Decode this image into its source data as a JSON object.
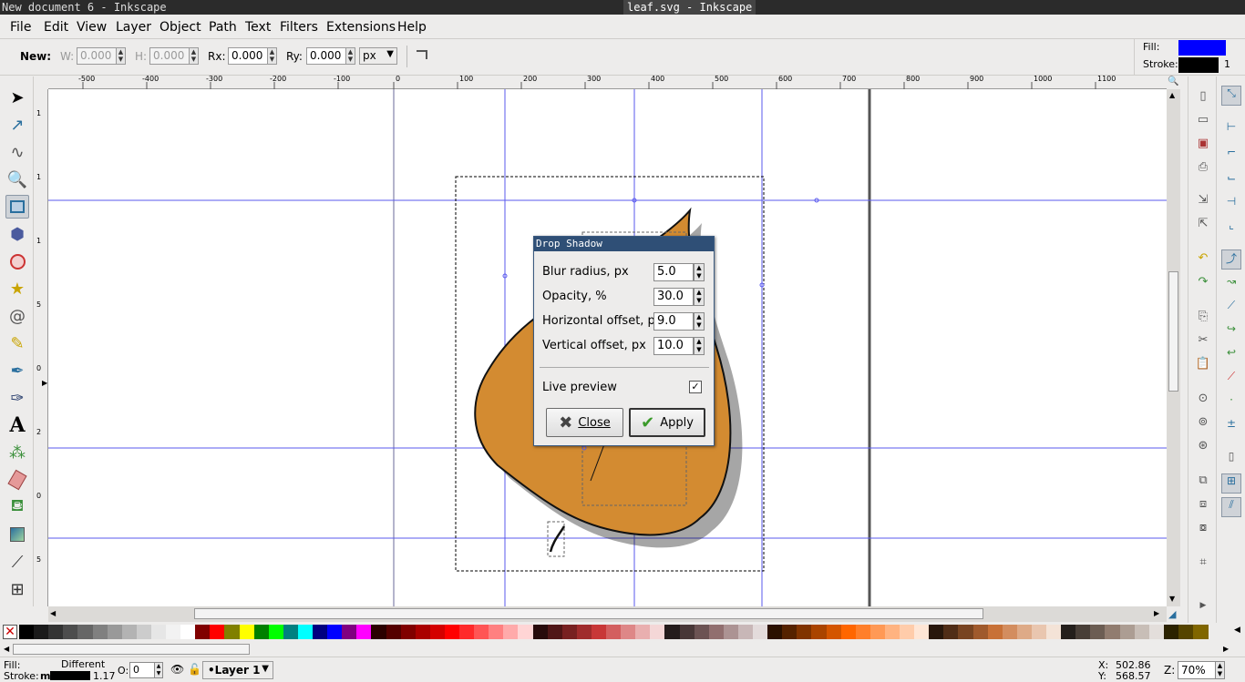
{
  "window": {
    "other_title": "New document 6 - Inkscape",
    "title": "leaf.svg - Inkscape"
  },
  "menu": [
    "File",
    "Edit",
    "View",
    "Layer",
    "Object",
    "Path",
    "Text",
    "Filters",
    "Extensions",
    "Help"
  ],
  "tool_controls": {
    "new_label": "New:",
    "w_label": "W:",
    "w_value": "0.000",
    "h_label": "H:",
    "h_value": "0.000",
    "rx_label": "Rx:",
    "rx_value": "0.000",
    "ry_label": "Ry:",
    "ry_value": "0.000",
    "unit": "px"
  },
  "style_indicator": {
    "fill_label": "Fill:",
    "stroke_label": "Stroke:",
    "stroke_width": "1",
    "fill_color": "#0000ff",
    "stroke_color": "#000000"
  },
  "tools": [
    "selector-icon",
    "node-icon",
    "tweak-icon",
    "zoom-icon",
    "rectangle-icon",
    "3dbox-icon",
    "ellipse-icon",
    "star-icon",
    "spiral-icon",
    "pencil-icon",
    "pen-icon",
    "calligraphy-icon",
    "text-icon",
    "spray-icon",
    "eraser-icon",
    "bucket-icon",
    "gradient-icon",
    "dropper-icon",
    "connector-icon"
  ],
  "ruler": {
    "h_ticks": [
      "-500",
      "-400",
      "-300",
      "-200",
      "-100",
      "0",
      "100",
      "200",
      "300",
      "400",
      "500",
      "600",
      "700",
      "800",
      "900",
      "1000",
      "1100"
    ],
    "v_ticks": [
      "1",
      "1",
      "1",
      "5",
      "0",
      "2",
      "0",
      "5",
      "0",
      "0",
      "6"
    ]
  },
  "dialog": {
    "title": "Drop Shadow",
    "blur_label": "Blur radius, px",
    "blur_value": "5.0",
    "opacity_label": "Opacity, %",
    "opacity_value": "30.0",
    "hoffset_label": "Horizontal offset, px",
    "hoffset_value": "9.0",
    "voffset_label": "Vertical offset, px",
    "voffset_value": "10.0",
    "live_preview_label": "Live preview",
    "live_preview_checked": "✓",
    "close_label": "Close",
    "apply_label": "Apply"
  },
  "palette": [
    "#000000",
    "#1a1a1a",
    "#333333",
    "#4d4d4d",
    "#666666",
    "#808080",
    "#999999",
    "#b3b3b3",
    "#cccccc",
    "#e6e6e6",
    "#f2f2f2",
    "#ffffff",
    "#800000",
    "#ff0000",
    "#808000",
    "#ffff00",
    "#008000",
    "#00ff00",
    "#008080",
    "#00ffff",
    "#000080",
    "#0000ff",
    "#800080",
    "#ff00ff",
    "#2b0000",
    "#550000",
    "#800000",
    "#aa0000",
    "#d40000",
    "#ff0000",
    "#ff2a2a",
    "#ff5555",
    "#ff8080",
    "#ffaaaa",
    "#ffd5d5",
    "#280b0b",
    "#501616",
    "#782121",
    "#a02c2c",
    "#c83737",
    "#d35f5f",
    "#de8787",
    "#e9afaf",
    "#f4d7d7",
    "#241c1c",
    "#483737",
    "#6c5353",
    "#916f6f",
    "#ac9393",
    "#c8b7b7",
    "#e3dbdb",
    "#2b1100",
    "#552200",
    "#803300",
    "#aa4400",
    "#d45500",
    "#ff6600",
    "#ff7f2a",
    "#ff9955",
    "#ffb380",
    "#ffccaa",
    "#ffe6d5",
    "#28170b",
    "#502d16",
    "#784421",
    "#a05a2c",
    "#c87137",
    "#d38d5f",
    "#deaa87",
    "#e9c6af",
    "#f4e3d7",
    "#241f1c",
    "#483e37",
    "#6c5d53",
    "#917c6f",
    "#ac9d93",
    "#c8beb7",
    "#e3dedb",
    "#2b2200",
    "#554400",
    "#806600"
  ],
  "status": {
    "fill_label": "Fill:",
    "fill_value": "Different",
    "stroke_label": "Stroke:",
    "stroke_value": "m",
    "stroke_width": "1.17",
    "opacity_label": "O:",
    "opacity_value": "0",
    "layer": "•Layer 1",
    "x_label": "X:",
    "x_value": "502.86",
    "y_label": "Y:",
    "y_value": "568.57",
    "zoom_label": "Z:",
    "zoom_value": "70%"
  }
}
